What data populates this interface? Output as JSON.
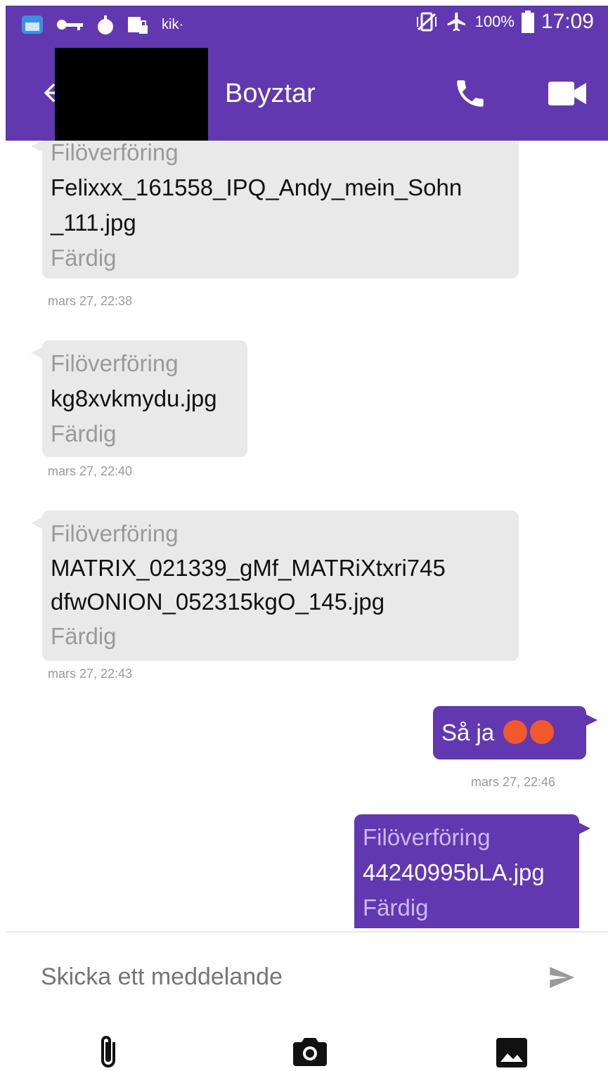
{
  "status_bar": {
    "kik_label": "kik·",
    "battery_percent": "100%",
    "time": "17:09"
  },
  "header": {
    "title": "Boyztar"
  },
  "messages": [
    {
      "direction": "in",
      "header": "Filöverföring",
      "filename": "Felixxx_161558_IPQ_Andy_mein_Sohn _111.jpg",
      "status": "Färdig",
      "timestamp": "mars 27, 22:38"
    },
    {
      "direction": "in",
      "header": "Filöverföring",
      "filename": "kg8xvkmydu.jpg",
      "status": "Färdig",
      "timestamp": "mars 27, 22:40"
    },
    {
      "direction": "in",
      "header": "Filöverföring",
      "filename": "MATRIX_021339_gMf_MATRiXtxri745 dfwONION_052315kgO_145.jpg",
      "status": "Färdig",
      "timestamp": "mars 27, 22:43"
    },
    {
      "direction": "out",
      "text": "Så ja",
      "emojis": [
        "angry-face-icon",
        "angry-face-icon"
      ],
      "timestamp": "mars 27, 22:46"
    },
    {
      "direction": "out",
      "header": "Filöverföring",
      "filename": "44240995bLA.jpg",
      "status": "Färdig"
    }
  ],
  "composer": {
    "placeholder": "Skicka ett meddelande"
  },
  "bottom_bar": {
    "icons": [
      "attach-icon",
      "camera-icon",
      "gallery-image-icon"
    ]
  },
  "colors": {
    "accent": "#6238b0",
    "incoming_bubble": "#e9e9e9",
    "muted_text": "#9a9a9a"
  }
}
